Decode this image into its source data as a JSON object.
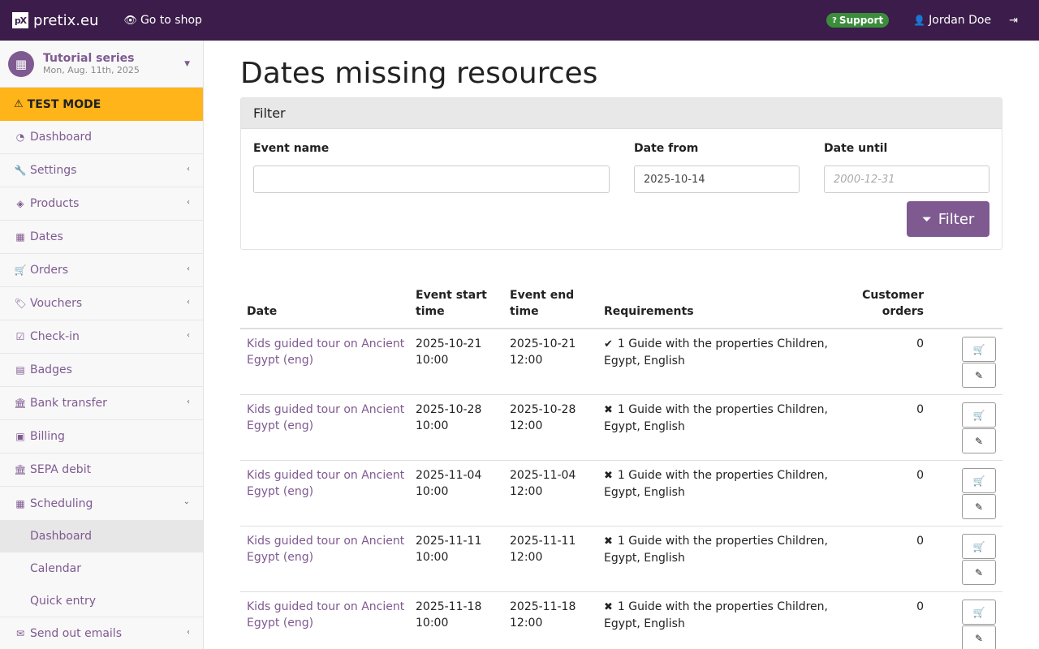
{
  "topbar": {
    "brand_logo": "pX",
    "brand": "pretix.eu",
    "go_to_shop": "Go to shop",
    "support": "Support",
    "user": "Jordan Doe"
  },
  "sidebar": {
    "event_name": "Tutorial series",
    "event_date": "Mon, Aug. 11th, 2025",
    "test_mode": "TEST MODE",
    "items": [
      {
        "label": "Dashboard",
        "icon": "dashboard-icon"
      },
      {
        "label": "Settings",
        "icon": "wrench-icon"
      },
      {
        "label": "Products",
        "icon": "ticket-icon"
      },
      {
        "label": "Dates",
        "icon": "calendar-icon"
      },
      {
        "label": "Orders",
        "icon": "cart-icon"
      },
      {
        "label": "Vouchers",
        "icon": "tags-icon"
      },
      {
        "label": "Check-in",
        "icon": "check-square-icon"
      },
      {
        "label": "Badges",
        "icon": "id-card-icon"
      },
      {
        "label": "Bank transfer",
        "icon": "bank-icon"
      },
      {
        "label": "Billing",
        "icon": "money-icon"
      },
      {
        "label": "SEPA debit",
        "icon": "bank-icon"
      },
      {
        "label": "Scheduling",
        "icon": "calendar-icon"
      },
      {
        "label": "Send out emails",
        "icon": "envelope-icon"
      }
    ],
    "scheduling_sub": [
      "Dashboard",
      "Calendar",
      "Quick entry"
    ]
  },
  "main": {
    "title": "Dates missing resources",
    "filter": {
      "heading": "Filter",
      "event_name_label": "Event name",
      "event_name_value": "",
      "date_from_label": "Date from",
      "date_from_value": "2025-10-14",
      "date_until_label": "Date until",
      "date_until_placeholder": "2000-12-31",
      "button": "Filter"
    },
    "table": {
      "headers": {
        "date": "Date",
        "start_1": "Event start",
        "start_2": "time",
        "end_1": "Event end",
        "end_2": "time",
        "requirements": "Requirements",
        "orders_1": "Customer",
        "orders_2": "orders"
      },
      "rows": [
        {
          "name_1": "Kids guided tour on Ancient",
          "name_2": "Egypt (eng)",
          "start_date": "2025-10-21",
          "start_time": "10:00",
          "end_date": "2025-10-21",
          "end_time": "12:00",
          "status": "✔",
          "req_1": "1 Guide with the properties Children,",
          "req_2": "Egypt, English",
          "orders": "0"
        },
        {
          "name_1": "Kids guided tour on Ancient",
          "name_2": "Egypt (eng)",
          "start_date": "2025-10-28",
          "start_time": "10:00",
          "end_date": "2025-10-28",
          "end_time": "12:00",
          "status": "✖",
          "req_1": "1 Guide with the properties Children,",
          "req_2": "Egypt, English",
          "orders": "0"
        },
        {
          "name_1": "Kids guided tour on Ancient",
          "name_2": "Egypt (eng)",
          "start_date": "2025-11-04",
          "start_time": "10:00",
          "end_date": "2025-11-04",
          "end_time": "12:00",
          "status": "✖",
          "req_1": "1 Guide with the properties Children,",
          "req_2": "Egypt, English",
          "orders": "0"
        },
        {
          "name_1": "Kids guided tour on Ancient",
          "name_2": "Egypt (eng)",
          "start_date": "2025-11-11",
          "start_time": "10:00",
          "end_date": "2025-11-11",
          "end_time": "12:00",
          "status": "✖",
          "req_1": "1 Guide with the properties Children,",
          "req_2": "Egypt, English",
          "orders": "0"
        },
        {
          "name_1": "Kids guided tour on Ancient",
          "name_2": "Egypt (eng)",
          "start_date": "2025-11-18",
          "start_time": "10:00",
          "end_date": "2025-11-18",
          "end_time": "12:00",
          "status": "✖",
          "req_1": "1 Guide with the properties Children,",
          "req_2": "Egypt, English",
          "orders": "0"
        }
      ]
    }
  }
}
